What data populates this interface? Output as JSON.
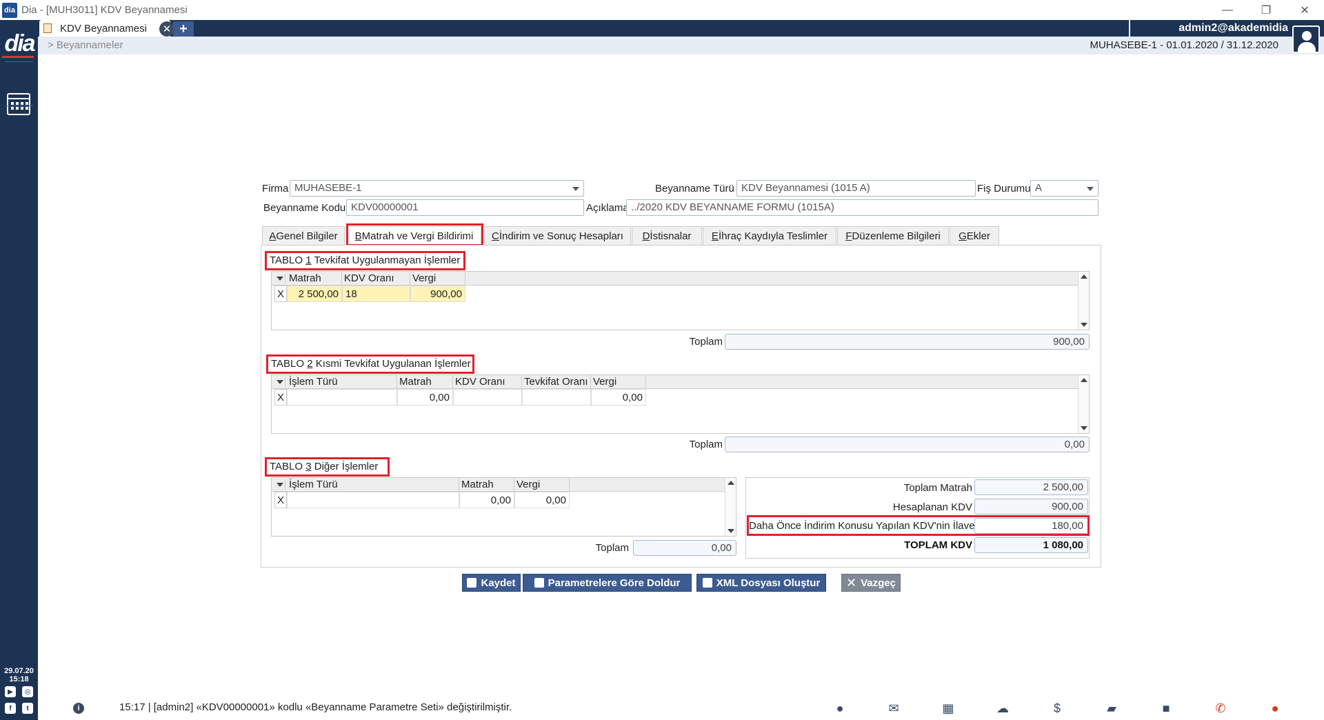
{
  "window": {
    "title": "Dia - [MUH3011] KDV Beyannamesi",
    "min": "—",
    "restore": "❐",
    "close": "✕"
  },
  "rail": {
    "logo": "dia",
    "date": "29.07.20",
    "time": "15:18"
  },
  "tabs": {
    "doc_tab": "KDV Beyannamesi",
    "close": "✕",
    "add": "+"
  },
  "user": "admin2@akademidia",
  "breadcrumb": "> Beyannameler",
  "period": "MUHASEBE-1 -  01.01.2020 / 31.12.2020",
  "form": {
    "firma_label": "Firma",
    "firma_value": "MUHASEBE-1",
    "beyanname_turu_label": "Beyanname Türü",
    "beyanname_turu_value": "KDV Beyannamesi (1015 A)",
    "fis_durumu_label": "Fiş Durumu",
    "fis_durumu_value": "A",
    "beyanname_kodu_label": "Beyanname Kodu",
    "beyanname_kodu_value": "KDV00000001",
    "aciklama_label": "Açıklama",
    "aciklama_value": "../2020 KDV BEYANNAME FORMU (1015A)"
  },
  "page_tabs": [
    {
      "key": "A",
      "label": " Genel Bilgiler"
    },
    {
      "key": "B",
      "label": " Matrah ve Vergi Bildirimi"
    },
    {
      "key": "C",
      "label": " İndirim ve Sonuç Hesapları"
    },
    {
      "key": "D",
      "label": " İstisnalar"
    },
    {
      "key": "E",
      "label": " İhraç Kaydıyla Teslimler"
    },
    {
      "key": "F",
      "label": " Düzenleme Bilgileri"
    },
    {
      "key": "G",
      "label": " Ekler"
    }
  ],
  "tablo1": {
    "prefix": "TABLO ",
    "num": "1",
    "title": " Tevkifat Uygulanmayan İşlemler",
    "columns": [
      "Matrah",
      "KDV Oranı",
      "Vergi"
    ],
    "row": {
      "marker": "X",
      "matrah": "2 500,00",
      "kdv_orani": "18",
      "vergi": "900,00"
    },
    "toplam_label": "Toplam",
    "toplam_value": "900,00"
  },
  "tablo2": {
    "prefix": "TABLO ",
    "num": "2",
    "title": " Kısmi Tevkifat Uygulanan İşlemler",
    "columns": [
      "İşlem Türü",
      "Matrah",
      "KDV Oranı",
      "Tevkifat Oranı",
      "Vergi"
    ],
    "row": {
      "marker": "X",
      "islem_turu": "",
      "matrah": "0,00",
      "kdv_orani": "",
      "tevkifat_orani": "",
      "vergi": "0,00"
    },
    "toplam_label": "Toplam",
    "toplam_value": "0,00"
  },
  "tablo3": {
    "prefix": "TABLO ",
    "num": "3",
    "title": " Diğer İşlemler",
    "columns": [
      "İşlem Türü",
      "Matrah",
      "Vergi"
    ],
    "row": {
      "marker": "X",
      "islem_turu": "",
      "matrah": "0,00",
      "vergi": "0,00"
    },
    "toplam_label": "Toplam",
    "toplam_value": "0,00"
  },
  "summary": {
    "toplam_matrah_label": "Toplam Matrah",
    "toplam_matrah_value": "2 500,00",
    "hesaplanan_kdv_label": "Hesaplanan KDV",
    "hesaplanan_kdv_value": "900,00",
    "ilave_label": "Daha Önce İndirim Konusu Yapılan KDV'nin İlavesi",
    "ilave_value": "180,00",
    "toplam_kdv_label": "TOPLAM KDV",
    "toplam_kdv_value": "1 080,00"
  },
  "buttons": {
    "kaydet": "Kaydet",
    "parametre": "Parametrelere Göre Doldur",
    "xml": "XML Dosyası Oluştur",
    "vazgec": "Vazgeç"
  },
  "status": {
    "message": "15:17 | [admin2] «KDV00000001» kodlu «Beyanname Parametre Seti» değiştirilmiştir.",
    "icons": [
      "help-icon",
      "mail-icon",
      "calculator-icon",
      "cloud-sync-icon",
      "currency-icon",
      "chat-icon",
      "lock-icon",
      "phone-icon",
      "record-icon"
    ]
  },
  "colors": {
    "accent": "#3c5b90",
    "rail": "#1d3354",
    "highlight": "#e2202c",
    "cell_yellow": "#fff3b5"
  }
}
